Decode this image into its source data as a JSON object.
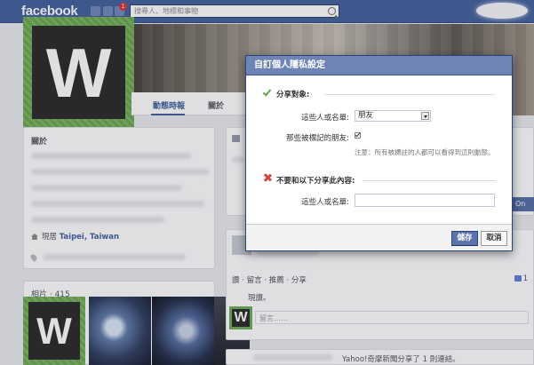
{
  "topbar": {
    "logo": "facebook",
    "notification_count": "1",
    "search_placeholder": "搜尋人、地標和事物"
  },
  "profile": {
    "avatar_letter": "W",
    "tabs": [
      {
        "label": "動態時報"
      },
      {
        "label": "關於"
      }
    ]
  },
  "about": {
    "title": "關於",
    "location_prefix": "現居",
    "location_value": "Taipei, Taiwan"
  },
  "photos": {
    "title": "相片 · 415"
  },
  "feed": {
    "post_actions": "讚 · 留言 · 推薦 · 分享",
    "post_snippet": "現讚。",
    "like_count": "1",
    "comment_placeholder": "留言……",
    "bottom_text": "Yahoo!奇摩新聞分享了 1 則連結。",
    "side_button": "On"
  },
  "dialog": {
    "title": "自訂個人隱私設定",
    "share_section": "分享對象:",
    "people_label": "這些人或名單:",
    "people_value": "朋友",
    "tagged_label": "那些被標記的朋友:",
    "tagged_note": "注意：所有被標註的人都可以看得到這則動態。",
    "exclude_section": "不要和以下分享此內容:",
    "exclude_label": "這些人或名單:",
    "save_label": "儲存",
    "cancel_label": "取消"
  },
  "colors": {
    "fb_blue": "#3b5998",
    "dialog_header": "#6d84b4",
    "check_green": "#5ba34a",
    "x_red": "#d0453e"
  }
}
